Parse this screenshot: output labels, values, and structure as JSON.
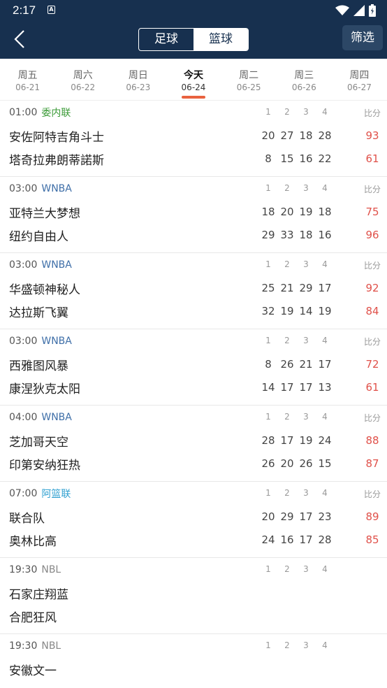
{
  "status": {
    "time": "2:17",
    "a_icon": "A"
  },
  "header": {
    "back_icon": "chevron-left",
    "tabs": [
      "足球",
      "篮球"
    ],
    "active_tab": 1,
    "filter_label": "筛选"
  },
  "dates": [
    {
      "day": "周五",
      "date": "06-21"
    },
    {
      "day": "周六",
      "date": "06-22"
    },
    {
      "day": "周日",
      "date": "06-23"
    },
    {
      "day": "今天",
      "date": "06-24"
    },
    {
      "day": "周二",
      "date": "06-25"
    },
    {
      "day": "周三",
      "date": "06-26"
    },
    {
      "day": "周四",
      "date": "06-27"
    }
  ],
  "active_date": 3,
  "colors": {
    "accent": "#e9623f",
    "header_bg": "#17304f",
    "score": "#e0514a",
    "wnba": "#3f6fa8",
    "venezuela": "#3a9a36",
    "asia": "#2e9fd0",
    "nbl": "#888888"
  },
  "matches": [
    {
      "time": "01:00",
      "league": "委内联",
      "league_color": "#3a9a36",
      "score_label": "比分",
      "quarter_labels": [
        "1",
        "2",
        "3",
        "4"
      ],
      "teams": [
        {
          "name": "安佐阿特吉角斗士",
          "q": [
            "20",
            "27",
            "18",
            "28"
          ],
          "total": "93"
        },
        {
          "name": "塔奇拉弗朗蒂諾斯",
          "q": [
            "8",
            "15",
            "16",
            "22"
          ],
          "total": "61"
        }
      ]
    },
    {
      "time": "03:00",
      "league": "WNBA",
      "league_color": "#3f6fa8",
      "score_label": "比分",
      "quarter_labels": [
        "1",
        "2",
        "3",
        "4"
      ],
      "teams": [
        {
          "name": "亚特兰大梦想",
          "q": [
            "18",
            "20",
            "19",
            "18"
          ],
          "total": "75"
        },
        {
          "name": "纽约自由人",
          "q": [
            "29",
            "33",
            "18",
            "16"
          ],
          "total": "96"
        }
      ]
    },
    {
      "time": "03:00",
      "league": "WNBA",
      "league_color": "#3f6fa8",
      "score_label": "比分",
      "quarter_labels": [
        "1",
        "2",
        "3",
        "4"
      ],
      "teams": [
        {
          "name": "华盛顿神秘人",
          "q": [
            "25",
            "21",
            "29",
            "17"
          ],
          "total": "92"
        },
        {
          "name": "达拉斯飞翼",
          "q": [
            "32",
            "19",
            "14",
            "19"
          ],
          "total": "84"
        }
      ]
    },
    {
      "time": "03:00",
      "league": "WNBA",
      "league_color": "#3f6fa8",
      "score_label": "比分",
      "quarter_labels": [
        "1",
        "2",
        "3",
        "4"
      ],
      "teams": [
        {
          "name": "西雅图风暴",
          "q": [
            "8",
            "26",
            "21",
            "17"
          ],
          "total": "72"
        },
        {
          "name": "康涅狄克太阳",
          "q": [
            "14",
            "17",
            "17",
            "13"
          ],
          "total": "61"
        }
      ]
    },
    {
      "time": "04:00",
      "league": "WNBA",
      "league_color": "#3f6fa8",
      "score_label": "比分",
      "quarter_labels": [
        "1",
        "2",
        "3",
        "4"
      ],
      "teams": [
        {
          "name": "芝加哥天空",
          "q": [
            "28",
            "17",
            "19",
            "24"
          ],
          "total": "88"
        },
        {
          "name": "印第安纳狂热",
          "q": [
            "26",
            "20",
            "26",
            "15"
          ],
          "total": "87"
        }
      ]
    },
    {
      "time": "07:00",
      "league": "阿篮联",
      "league_color": "#2e9fd0",
      "score_label": "比分",
      "quarter_labels": [
        "1",
        "2",
        "3",
        "4"
      ],
      "teams": [
        {
          "name": "联合队",
          "q": [
            "20",
            "29",
            "17",
            "23"
          ],
          "total": "89"
        },
        {
          "name": "奥林比高",
          "q": [
            "24",
            "16",
            "17",
            "28"
          ],
          "total": "85"
        }
      ]
    },
    {
      "time": "19:30",
      "league": "NBL",
      "league_color": "#888888",
      "score_label": "",
      "quarter_labels": [
        "1",
        "2",
        "3",
        "4"
      ],
      "teams": [
        {
          "name": "石家庄翔蓝",
          "q": [
            "",
            "",
            "",
            ""
          ],
          "total": ""
        },
        {
          "name": "合肥狂风",
          "q": [
            "",
            "",
            "",
            ""
          ],
          "total": ""
        }
      ]
    },
    {
      "time": "19:30",
      "league": "NBL",
      "league_color": "#888888",
      "score_label": "",
      "quarter_labels": [
        "1",
        "2",
        "3",
        "4"
      ],
      "teams": [
        {
          "name": "安徽文一",
          "q": [
            "",
            "",
            "",
            ""
          ],
          "total": ""
        }
      ]
    }
  ]
}
